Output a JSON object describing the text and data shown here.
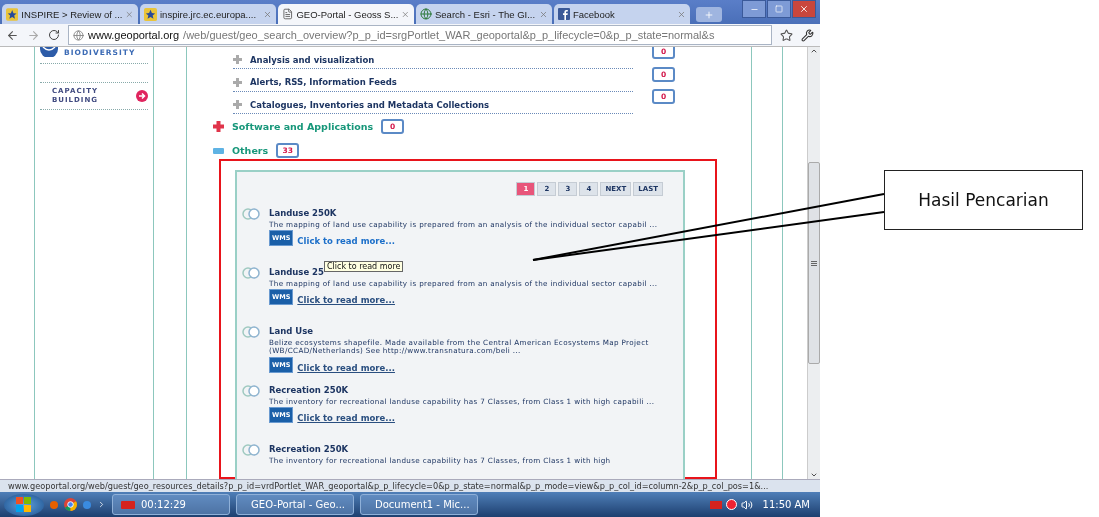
{
  "browser": {
    "tabs": [
      {
        "title": "INSPIRE > Review of ...",
        "kind": "star",
        "selected": false
      },
      {
        "title": "inspire.jrc.ec.europa....",
        "kind": "star",
        "selected": false
      },
      {
        "title": "GEO-Portal - Geoss S...",
        "kind": "page",
        "selected": true
      },
      {
        "title": "Search - Esri - The GI...",
        "kind": "globe",
        "selected": false
      },
      {
        "title": "Facebook",
        "kind": "facebook",
        "selected": false
      }
    ],
    "url_host": "www.geoportal.org",
    "url_path": "/web/guest/geo_search_overview?p_p_id=srgPortlet_WAR_geoportal&p_p_lifecycle=0&p_p_state=normal&s"
  },
  "sidebar": {
    "items": [
      {
        "label": "BIODIVERSITY",
        "kind": "logo"
      },
      {
        "label": "CAPACITY BUILDING",
        "kind": "link"
      }
    ]
  },
  "subcategories": [
    {
      "label": "Analysis and visualization",
      "count": "0"
    },
    {
      "label": "Alerts, RSS, Information Feeds",
      "count": "0"
    },
    {
      "label": "Catalogues, Inventories and Metadata Collections",
      "count": "0"
    }
  ],
  "categories": [
    {
      "label": "Software and Applications",
      "count": "0",
      "expanded": false
    },
    {
      "label": "Others",
      "count": "33",
      "expanded": true
    }
  ],
  "pagination": [
    {
      "label": "1",
      "selected": true
    },
    {
      "label": "2",
      "selected": false
    },
    {
      "label": "3",
      "selected": false
    },
    {
      "label": "4",
      "selected": false
    },
    {
      "label": "NEXT",
      "selected": false
    },
    {
      "label": "LAST",
      "selected": false
    }
  ],
  "results": [
    {
      "title": "Landuse 250K",
      "description": "The mapping of land use capability is prepared from an analysis of the individual sector capabil ...",
      "badge": "WMS",
      "link": "Click to read more...",
      "hovered": true
    },
    {
      "title": "Landuse 25",
      "tooltip": "Click to read more",
      "description": "The mapping of land use capability is prepared from an analysis of the individual sector capabil ...",
      "badge": "WMS",
      "link": "Click to read more...",
      "hovered": false
    },
    {
      "title": "Land Use",
      "description": "Belize ecosystems shapefile. Made available from the Central American Ecosystems Map Project (WB/CCAD/Netherlands) See http://www.transnatura.com/beli ...",
      "badge": "WMS",
      "link": "Click to read more...",
      "hovered": false
    },
    {
      "title": "Recreation 250K",
      "description": "The inventory for recreational landuse capability has 7 Classes, from Class 1 with high capabili ...",
      "badge": "WMS",
      "link": "Click to read more...",
      "hovered": false
    },
    {
      "title": "Recreation 250K",
      "description": "The inventory for recreational landuse capability has 7 Classes, from Class 1 with high"
    }
  ],
  "status_bar": "www.geoportal.org/web/guest/geo_resources_details?p_p_id=vrdPortlet_WAR_geoportal&p_p_lifecycle=0&p_p_state=normal&p_p_mode=view&p_p_col_id=column-2&p_p_col_pos=1&...",
  "taskbar": {
    "tasks": [
      {
        "label": "00:12:29",
        "kind": "recorder"
      },
      {
        "label": "GEO-Portal - Geo...",
        "kind": "chrome"
      },
      {
        "label": "Document1 - Mic...",
        "kind": "word"
      }
    ],
    "clock": "11:50 AM"
  },
  "callout": {
    "label": "Hasil Pencarian"
  }
}
